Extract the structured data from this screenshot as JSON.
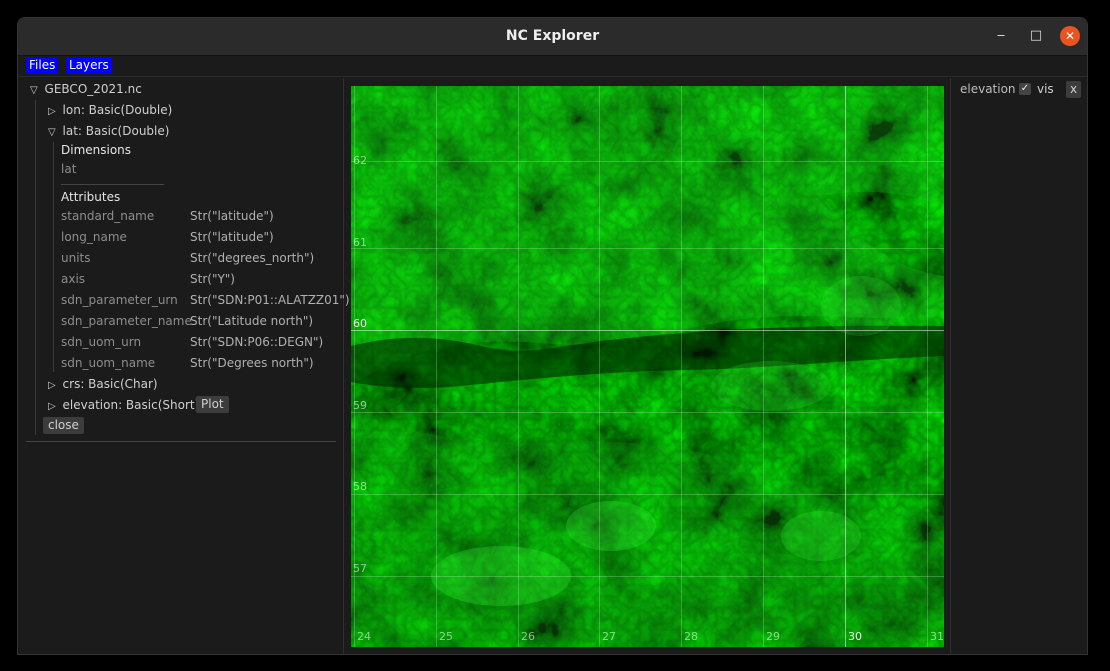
{
  "window": {
    "title": "NC Explorer"
  },
  "menu": {
    "files": "Files",
    "layers": "Layers"
  },
  "tree": {
    "file": "GEBCO_2021.nc",
    "lon": "lon: Basic(Double)",
    "lat": "lat: Basic(Double)",
    "dimensions_header": "Dimensions",
    "dimension": "lat",
    "attributes_header": "Attributes",
    "attributes": [
      {
        "name": "standard_name",
        "value": "Str(\"latitude\")"
      },
      {
        "name": "long_name",
        "value": "Str(\"latitude\")"
      },
      {
        "name": "units",
        "value": "Str(\"degrees_north\")"
      },
      {
        "name": "axis",
        "value": "Str(\"Y\")"
      },
      {
        "name": "sdn_parameter_urn",
        "value": "Str(\"SDN:P01::ALATZZ01\")"
      },
      {
        "name": "sdn_parameter_name",
        "value": "Str(\"Latitude north\")"
      },
      {
        "name": "sdn_uom_urn",
        "value": "Str(\"SDN:P06::DEGN\")"
      },
      {
        "name": "sdn_uom_name",
        "value": "Str(\"Degrees north\")"
      }
    ],
    "crs": "crs: Basic(Char)",
    "elevation": "elevation: Basic(Short)",
    "plot_label": "Plot",
    "close_label": "close"
  },
  "map": {
    "lat_labels": [
      "62",
      "61",
      "60",
      "59",
      "58",
      "57"
    ],
    "lon_labels": [
      "24",
      "25",
      "26",
      "27",
      "28",
      "29",
      "30",
      "31"
    ]
  },
  "layers": {
    "name": "elevation",
    "visible": true,
    "vis_label": "vis",
    "check_glyph": "✓",
    "remove_label": "x"
  },
  "icons": {
    "expanded": "▽",
    "collapsed": "▷",
    "minimize": "‒",
    "maximize": "□",
    "close": "✕"
  }
}
